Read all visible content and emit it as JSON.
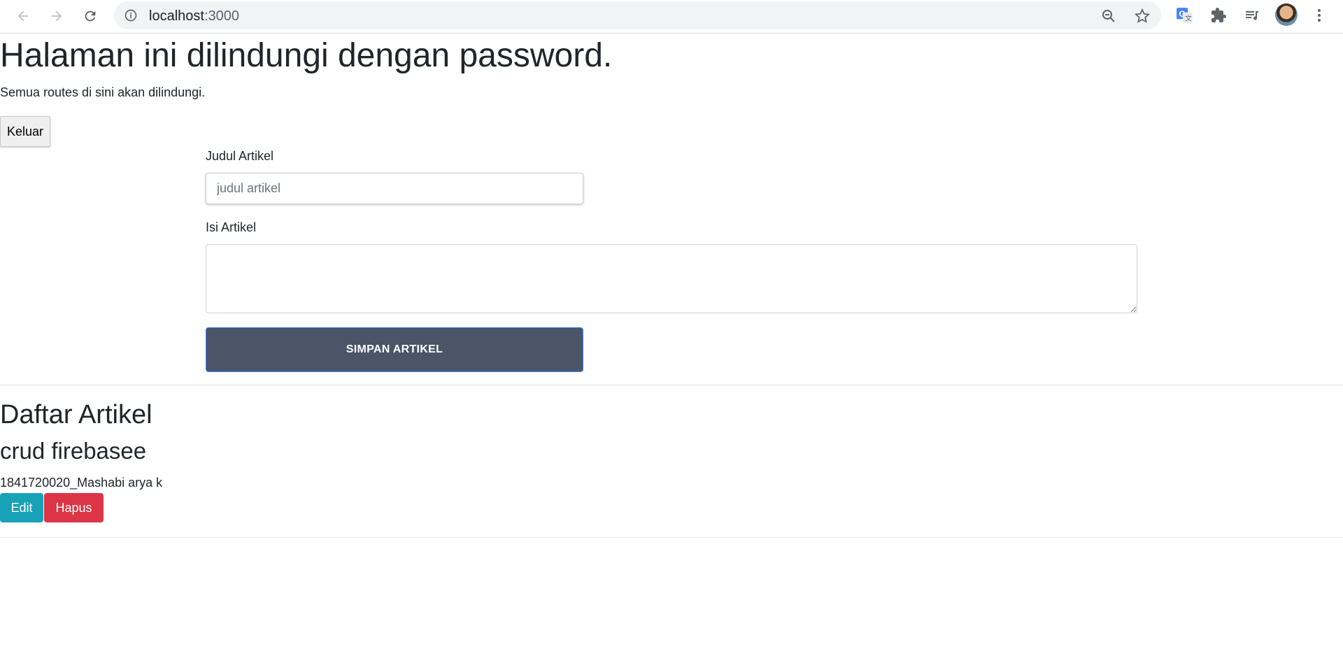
{
  "browser": {
    "url_host": "localhost",
    "url_port": ":3000",
    "icons": [
      "back-arrow-icon",
      "forward-arrow-icon",
      "reload-icon",
      "info-icon",
      "zoom-icon",
      "star-icon",
      "google-translate-icon",
      "extensions-icon",
      "media-control-icon",
      "profile-avatar",
      "menu-dots-icon"
    ]
  },
  "page": {
    "title": "Halaman ini dilindungi dengan password.",
    "subtitle": "Semua routes di sini akan dilindungi.",
    "logout_label": "Keluar"
  },
  "form": {
    "title_label": "Judul Artikel",
    "title_placeholder": "judul artikel",
    "title_value": "",
    "body_label": "Isi Artikel",
    "body_value": "",
    "submit_label": "SIMPAN ARTIKEL"
  },
  "articles": {
    "heading": "Daftar Artikel",
    "items": [
      {
        "title": "crud firebasee",
        "body": "1841720020_Mashabi arya k",
        "edit_label": "Edit",
        "delete_label": "Hapus"
      }
    ]
  },
  "colors": {
    "submit_bg": "#4a5568",
    "edit_bg": "#17a2b8",
    "delete_bg": "#dc3545"
  }
}
